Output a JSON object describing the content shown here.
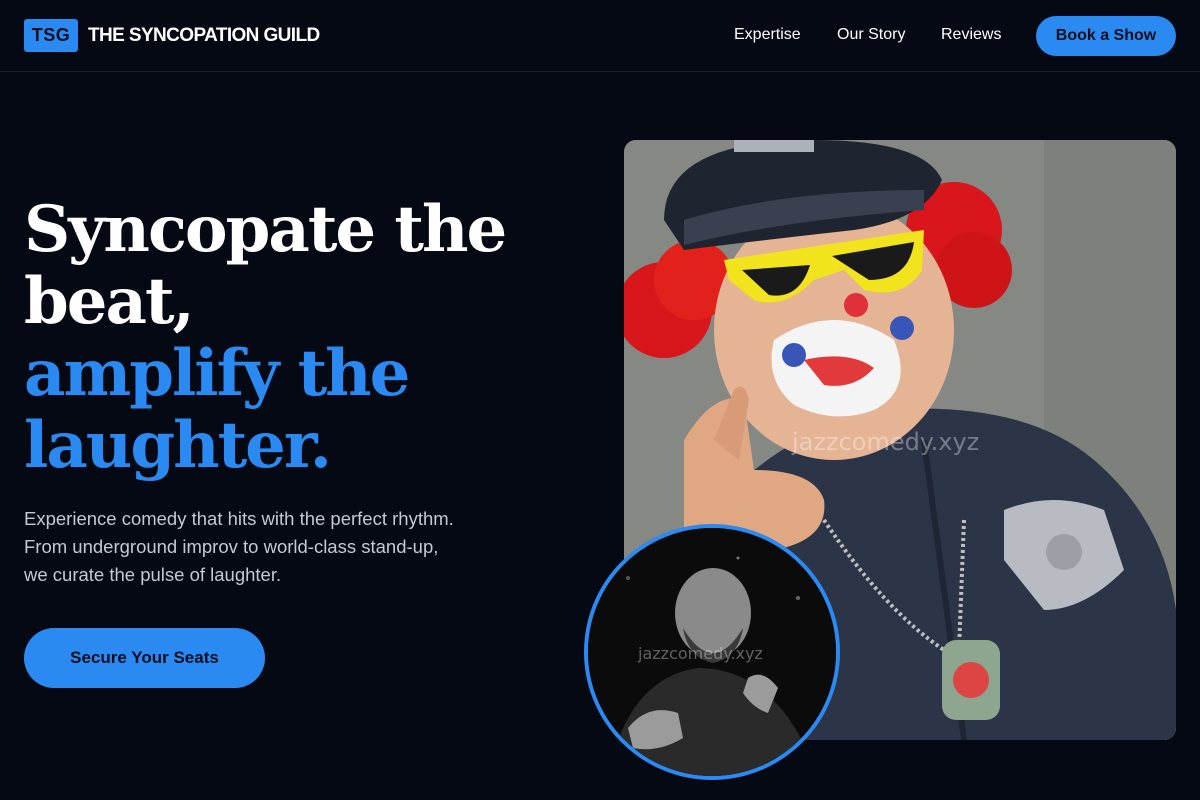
{
  "header": {
    "badge": "TSG",
    "brand": "THE SYNCOPATION GUILD",
    "nav": [
      "Expertise",
      "Our Story",
      "Reviews"
    ],
    "cta": "Book a Show"
  },
  "hero": {
    "headline": [
      "Syncopate the",
      "beat,"
    ],
    "headline_accent": [
      "amplify the",
      "laughter."
    ],
    "subtitle": [
      "Experience comedy that hits with the perfect rhythm.",
      "From underground improv to world-class stand-up,",
      "we curate the pulse of laughter."
    ],
    "cta": "Secure Your Seats"
  },
  "photos": {
    "main_watermark": "jazzcomedy.xyz",
    "inset_watermark": "jazzcomedy.xyz"
  },
  "colors": {
    "background": "#050914",
    "accent": "#2b8af2",
    "muted_text": "#c4c9d4"
  }
}
